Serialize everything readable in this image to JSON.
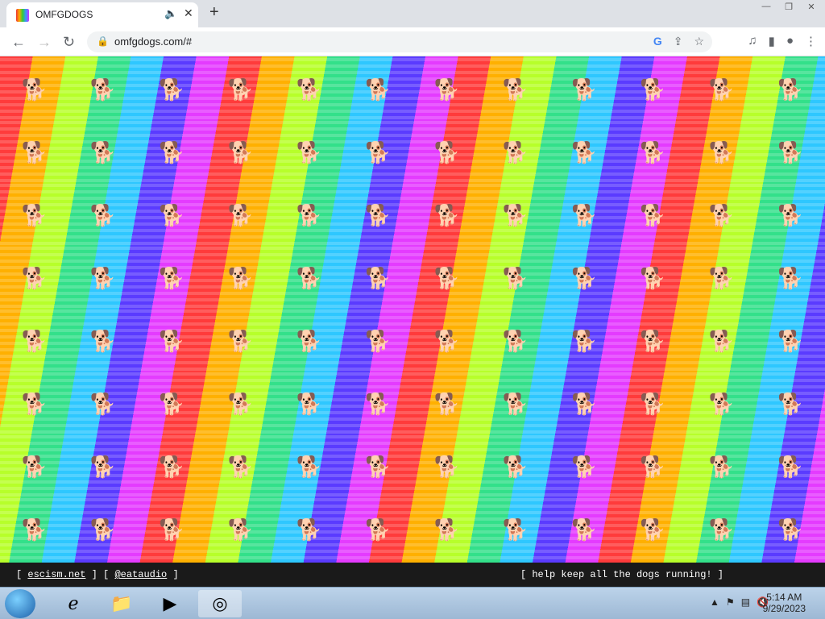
{
  "browser": {
    "tab_title": "OMFGDOGS",
    "url": "omfgdogs.com/#",
    "icons": [
      "favicon-icon",
      "speaker-icon",
      "close-icon",
      "plus-icon",
      "back-icon",
      "forward-icon",
      "reload-icon",
      "lock-icon",
      "google-icon",
      "share-icon",
      "star-icon",
      "media-icon",
      "sidepanel-icon",
      "profile-icon",
      "menu-icon"
    ]
  },
  "page": {
    "background": "rainbow running dogs pattern",
    "footer": {
      "left_open1": "[",
      "escism_link": "escism.net",
      "left_close1": "] [",
      "eataudio_link": "@eataudio",
      "left_close2": "]",
      "right_text": "[ help keep all the dogs running! ]"
    }
  },
  "taskbar": {
    "time": "5:14 AM",
    "date": "9/29/2023",
    "icons": [
      "start-icon",
      "ie-icon",
      "explorer-icon",
      "media-player-icon",
      "chrome-icon"
    ]
  },
  "colors": {
    "tabbar": "#dee1e6",
    "footer": "#1a1a1a",
    "taskbar": "#bcd3ea"
  }
}
